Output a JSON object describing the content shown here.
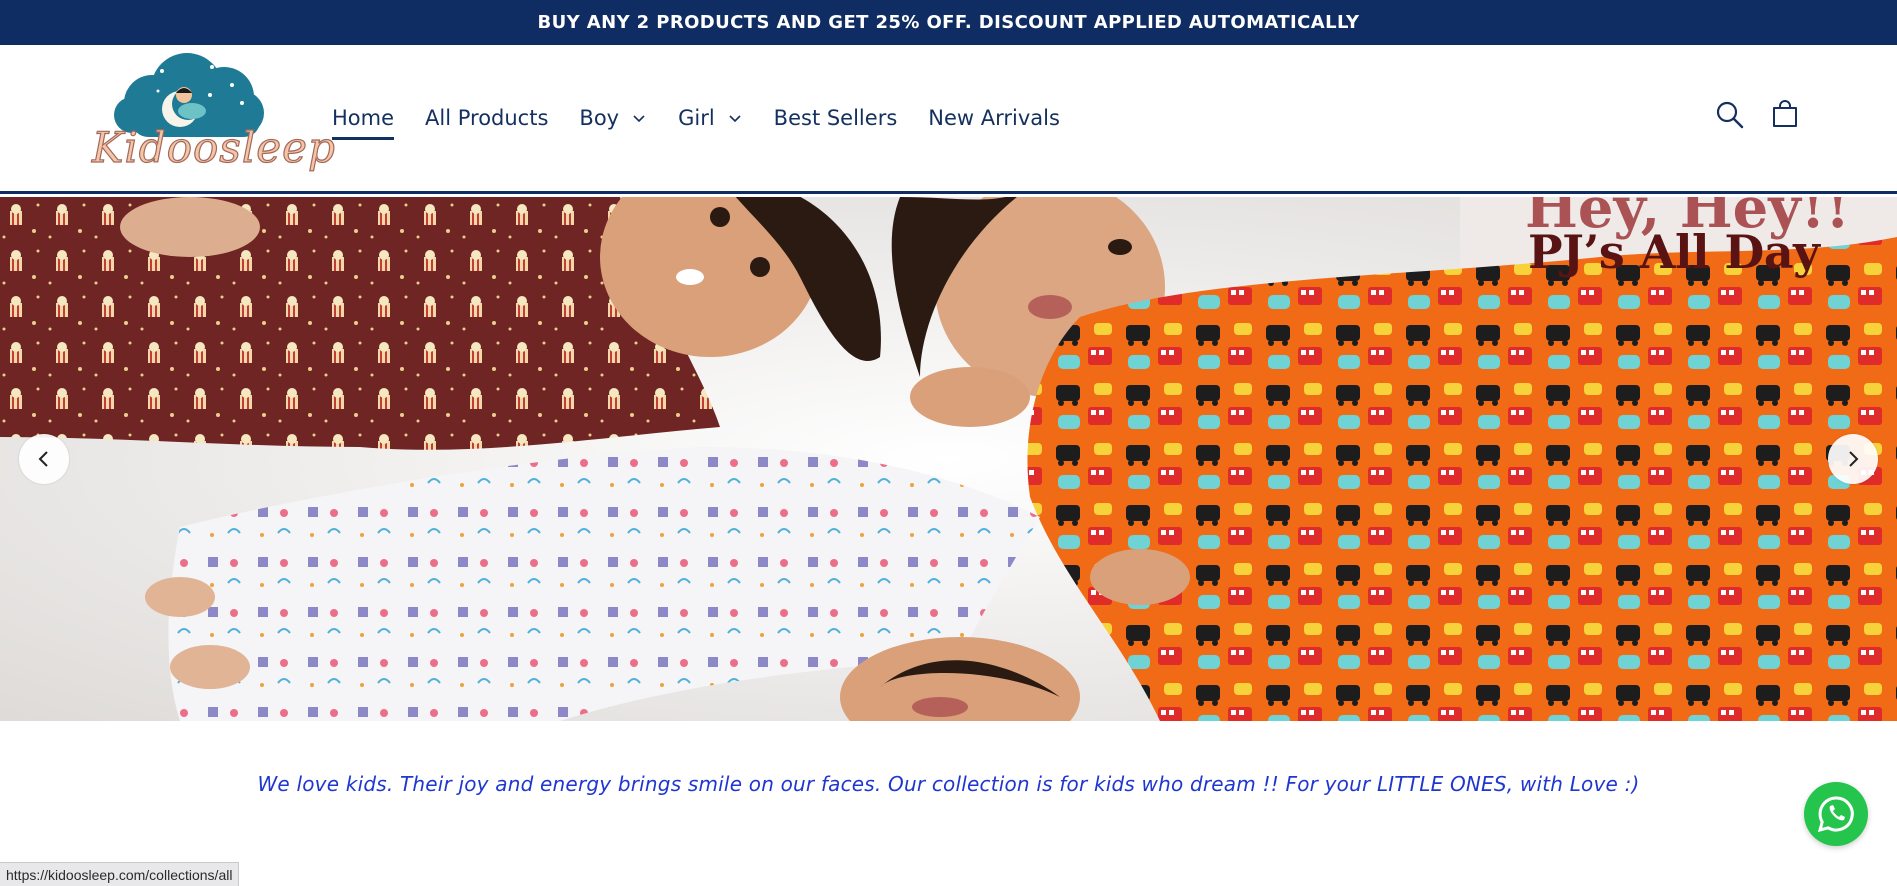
{
  "announcement": {
    "text": "BUY ANY 2 PRODUCTS AND GET 25% OFF. DISCOUNT APPLIED AUTOMATICALLY"
  },
  "brand": {
    "logo_text": "Kidoosleep",
    "navy": "#0f2d62",
    "accent_blue": "#1f37d0"
  },
  "nav": {
    "items": [
      {
        "label": "Home",
        "active": true,
        "dropdown": false
      },
      {
        "label": "All Products",
        "active": false,
        "dropdown": false
      },
      {
        "label": "Boy",
        "active": false,
        "dropdown": true
      },
      {
        "label": "Girl",
        "active": false,
        "dropdown": true
      },
      {
        "label": "Best Sellers",
        "active": false,
        "dropdown": false
      },
      {
        "label": "New Arrivals",
        "active": false,
        "dropdown": false
      }
    ]
  },
  "header_icons": {
    "search": "search-icon",
    "cart": "cart-icon"
  },
  "hero": {
    "heading_partial": "Hey, Hey!!",
    "heading": "PJ’s All Day",
    "prev_icon": "chevron-left-icon",
    "next_icon": "chevron-right-icon"
  },
  "tagline": "We love kids. Their joy and energy brings smile on our faces. Our collection is for kids who dream !! For your LITTLE ONES, with Love :)",
  "whatsapp": {
    "icon": "whatsapp-icon",
    "color": "#25c44d"
  },
  "status_bar": {
    "url": "https://kidoosleep.com/collections/all"
  }
}
